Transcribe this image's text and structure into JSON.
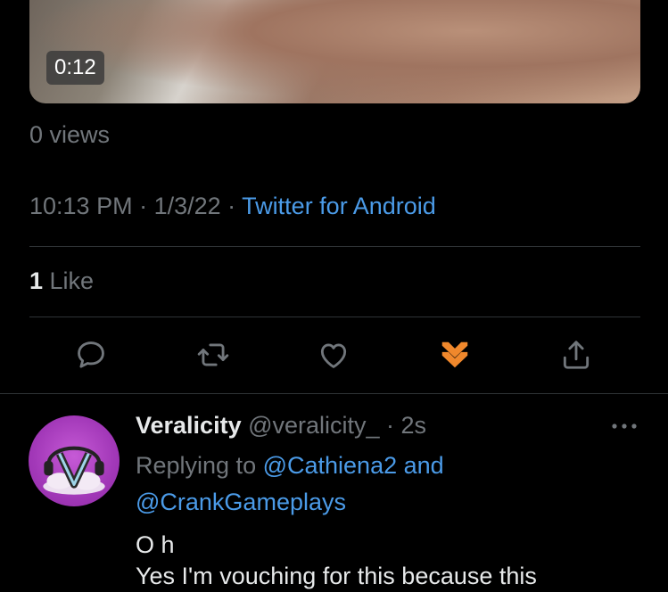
{
  "video": {
    "duration": "0:12"
  },
  "views": "0 views",
  "meta": {
    "time": "10:13 PM",
    "sep1": " · ",
    "date": "1/3/22",
    "sep2": " · ",
    "source": "Twitter for Android"
  },
  "likes": {
    "count": "1",
    "label": " Like"
  },
  "actions": [
    {
      "icon": "reply-icon"
    },
    {
      "icon": "retweet-icon"
    },
    {
      "icon": "heart-icon"
    },
    {
      "icon": "brave-tip-icon",
      "color": "#f0882c"
    },
    {
      "icon": "share-icon"
    }
  ],
  "reply": {
    "name": "Veralicity",
    "handle": " @veralicity_",
    "time": " · 2s",
    "replying_prefix": "Replying to ",
    "mention1": "@Cathiena2",
    "and": " and",
    "mention2": "@CrankGameplays",
    "text_line1": "O h",
    "text_line2": "Yes I'm vouching for this because this"
  },
  "colors": {
    "link": "#4b9be8",
    "muted": "#71767b",
    "text": "#e7e9ea",
    "background": "#000000"
  }
}
